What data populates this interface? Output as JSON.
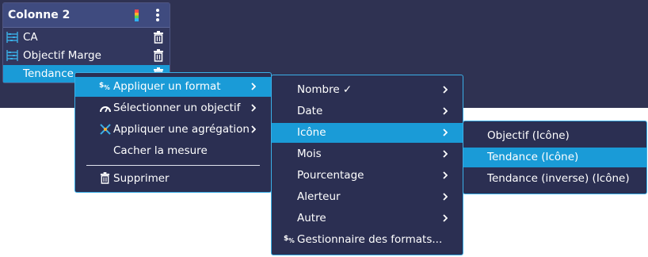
{
  "panel": {
    "title": "Colonne 2",
    "rows": [
      {
        "label": "CA"
      },
      {
        "label": "Objectif Marge"
      },
      {
        "label": "Tendance"
      }
    ]
  },
  "menu1": {
    "items": [
      {
        "label": "Appliquer un format",
        "icon": "percent-format-icon"
      },
      {
        "label": "Sélectionner un objectif",
        "icon": "gauge-icon"
      },
      {
        "label": "Appliquer une agrégation",
        "icon": "aggregation-icon"
      },
      {
        "label": "Cacher la mesure"
      }
    ],
    "delete_label": "Supprimer"
  },
  "menu2": {
    "items": [
      {
        "label": "Nombre ✓"
      },
      {
        "label": "Date"
      },
      {
        "label": "Icône"
      },
      {
        "label": "Mois"
      },
      {
        "label": "Pourcentage"
      },
      {
        "label": "Alerteur"
      },
      {
        "label": "Autre"
      }
    ],
    "manager_label": "Gestionnaire des formats..."
  },
  "menu3": {
    "items": [
      {
        "label": "Objectif (Icône)"
      },
      {
        "label": "Tendance (Icône)"
      },
      {
        "label": "Tendance (inverse) (Icône)"
      }
    ]
  },
  "colors": {
    "accent": "#1a9bd7",
    "menu_bg": "#2b2f52",
    "panel_bg": "#32375e",
    "header_bg": "#3f4b7f"
  }
}
